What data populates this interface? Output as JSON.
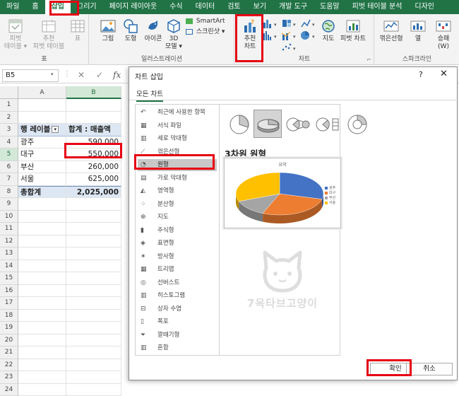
{
  "ribbon_tabs": [
    "파일",
    "홈",
    "삽입",
    "그리기",
    "페이지 레이아웃",
    "수식",
    "데이터",
    "검토",
    "보기",
    "개발 도구",
    "도움말",
    "피벗 테이블 분석",
    "디자인"
  ],
  "ribbon": {
    "tables": {
      "pivot": "피벗\n테이블 ▾",
      "recommended_pivot": "추천\n피벗 테이블",
      "table": "표",
      "group_label": "표"
    },
    "illustrations": {
      "picture": "그림",
      "shapes": "도형",
      "icons": "아이콘",
      "model3d": "3D\n모델 ▾",
      "smartart": "SmartArt",
      "screenshot": "스크린샷 ▾",
      "group_label": "일러스트레이션"
    },
    "charts": {
      "recommended": "추천\n차트",
      "maps": "지도",
      "pivot_chart": "피벗 차트",
      "group_label": "차트"
    },
    "sparklines": {
      "line": "꺾은선형",
      "column": "열",
      "winloss": "승패\n(W)",
      "group_label": "스파크라인"
    }
  },
  "formula_bar": {
    "namebox": "B5",
    "cancel": "✕",
    "enter": "✓",
    "fx": "fx"
  },
  "sheet": {
    "columns": [
      "A",
      "B"
    ],
    "rows": [
      "1",
      "2",
      "3",
      "4",
      "5",
      "6",
      "7",
      "8",
      "9",
      "10",
      "11",
      "12",
      "13",
      "14",
      "15",
      "16",
      "17",
      "18",
      "19",
      "20",
      "21",
      "22",
      "23",
      "24"
    ],
    "header": {
      "a": "행 레이블",
      "b": "합계 : 매출액"
    },
    "data": [
      {
        "region": "광주",
        "sales": "590,000"
      },
      {
        "region": "대구",
        "sales": "550,000"
      },
      {
        "region": "부산",
        "sales": "260,000"
      },
      {
        "region": "서울",
        "sales": "625,000"
      }
    ],
    "total": {
      "label": "총합계",
      "value": "2,025,000"
    },
    "active_cell": "B5"
  },
  "dialog": {
    "title": "차트 삽입",
    "help": "?",
    "close": "✕",
    "tab": "모든 차트",
    "categories": [
      "최근에 사용한 항목",
      "서식 파일",
      "세로 막대형",
      "꺾은선형",
      "원형",
      "가로 막대형",
      "영역형",
      "분산형",
      "지도",
      "주식형",
      "표면형",
      "방사형",
      "트리맵",
      "선버스트",
      "히스토그램",
      "상자 수염",
      "폭포",
      "깔때기형",
      "혼합"
    ],
    "selected_category": "원형",
    "chart_subtype_title": "3차원 원형",
    "preview": {
      "title": "요약",
      "legend": [
        "광주",
        "대구",
        "부산",
        "서울"
      ],
      "slices": [
        {
          "label": "광주",
          "value": 590000,
          "color": "#4472c4"
        },
        {
          "label": "대구",
          "value": 550000,
          "color": "#ed7d31"
        },
        {
          "label": "부산",
          "value": 260000,
          "color": "#a5a5a5"
        },
        {
          "label": "서울",
          "value": 625000,
          "color": "#ffc000"
        }
      ]
    },
    "watermark": "7옥타브고양이",
    "ok": "확인",
    "cancel": "취소"
  },
  "colors": {
    "excel_green": "#217346",
    "highlight_red": "#e60012",
    "pivot_blue": "#dde7f3"
  }
}
